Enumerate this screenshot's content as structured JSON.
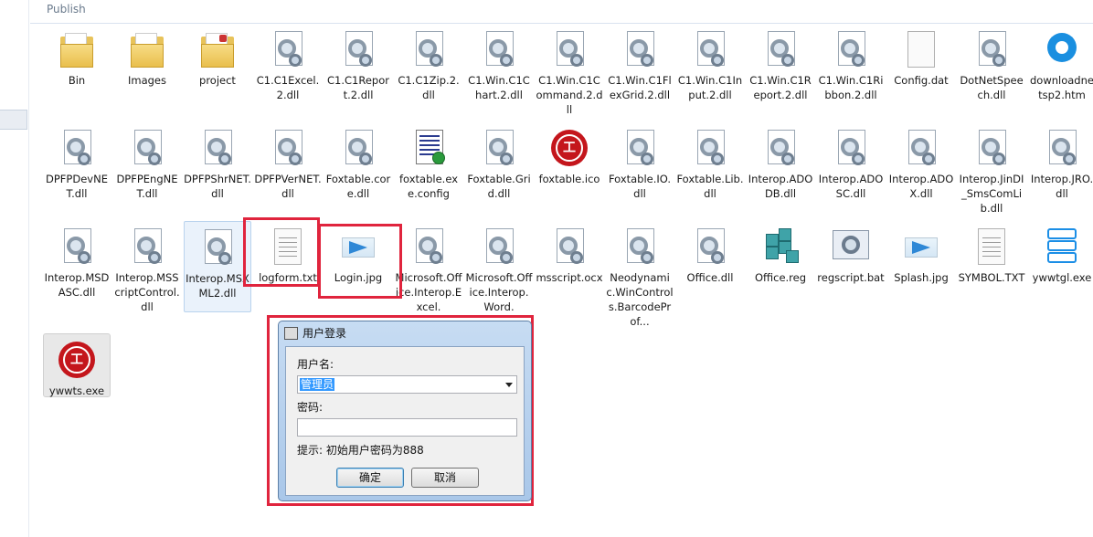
{
  "breadcrumb": "Publish",
  "files": [
    {
      "label": "Bin",
      "icon": "folder-icon"
    },
    {
      "label": "Images",
      "icon": "folder-icon"
    },
    {
      "label": "project",
      "icon": "folder-lock-icon"
    },
    {
      "label": "C1.C1Excel.2.dll",
      "icon": "dll-icon"
    },
    {
      "label": "C1.C1Report.2.dll",
      "icon": "dll-icon"
    },
    {
      "label": "C1.C1Zip.2.dll",
      "icon": "dll-icon"
    },
    {
      "label": "C1.Win.C1Chart.2.dll",
      "icon": "dll-icon"
    },
    {
      "label": "C1.Win.C1Command.2.dll",
      "icon": "dll-icon"
    },
    {
      "label": "C1.Win.C1FlexGrid.2.dll",
      "icon": "dll-icon"
    },
    {
      "label": "C1.Win.C1Input.2.dll",
      "icon": "dll-icon"
    },
    {
      "label": "C1.Win.C1Report.2.dll",
      "icon": "dll-icon"
    },
    {
      "label": "C1.Win.C1Ribbon.2.dll",
      "icon": "dll-icon"
    },
    {
      "label": "Config.dat",
      "icon": "blank-file-icon"
    },
    {
      "label": "DotNetSpeech.dll",
      "icon": "dll-icon"
    },
    {
      "label": "downloadnetsp2.htm",
      "icon": "browser-icon"
    },
    {
      "label": "DPFPDevNET.dll",
      "icon": "dll-icon"
    },
    {
      "label": "DPFPEngNET.dll",
      "icon": "dll-icon"
    },
    {
      "label": "DPFPShrNET.dll",
      "icon": "dll-icon"
    },
    {
      "label": "DPFPVerNET.dll",
      "icon": "dll-icon"
    },
    {
      "label": "Foxtable.core.dll",
      "icon": "dll-icon"
    },
    {
      "label": "foxtable.exe.config",
      "icon": "config-file-icon"
    },
    {
      "label": "Foxtable.Grid.dll",
      "icon": "dll-icon"
    },
    {
      "label": "foxtable.ico",
      "icon": "red-logo-icon"
    },
    {
      "label": "Foxtable.IO.dll",
      "icon": "dll-icon"
    },
    {
      "label": "Foxtable.Lib.dll",
      "icon": "dll-icon"
    },
    {
      "label": "Interop.ADODB.dll",
      "icon": "dll-icon"
    },
    {
      "label": "Interop.ADOSC.dll",
      "icon": "dll-icon"
    },
    {
      "label": "Interop.ADOX.dll",
      "icon": "dll-icon"
    },
    {
      "label": "Interop.JinDI_SmsComLib.dll",
      "icon": "dll-icon"
    },
    {
      "label": "Interop.JRO.dll",
      "icon": "dll-icon"
    },
    {
      "label": "Interop.MSDASC.dll",
      "icon": "dll-icon"
    },
    {
      "label": "Interop.MSScriptControl.dll",
      "icon": "dll-icon"
    },
    {
      "label": "Interop.MSXML2.dll",
      "icon": "dll-icon"
    },
    {
      "label": "logform.txt",
      "icon": "text-file-icon"
    },
    {
      "label": "Login.jpg",
      "icon": "image-file-icon"
    },
    {
      "label": "Microsoft.Office.Interop.Excel.",
      "icon": "dll-icon"
    },
    {
      "label": "Microsoft.Office.Interop.Word.",
      "icon": "dll-icon"
    },
    {
      "label": "msscript.ocx",
      "icon": "dll-icon"
    },
    {
      "label": "Neodynamic.WinControls.BarcodeProf...",
      "icon": "dll-icon"
    },
    {
      "label": "Office.dll",
      "icon": "dll-icon"
    },
    {
      "label": "Office.reg",
      "icon": "registry-file-icon"
    },
    {
      "label": "regscript.bat",
      "icon": "batch-file-icon"
    },
    {
      "label": "Splash.jpg",
      "icon": "image-file-icon"
    },
    {
      "label": "SYMBOL.TXT",
      "icon": "text-file-icon"
    },
    {
      "label": "ywwtgl.exe",
      "icon": "app-icon"
    },
    {
      "label": "ywwts.exe",
      "icon": "red-logo-icon"
    }
  ],
  "dialog": {
    "title": "用户登录",
    "username_label": "用户名:",
    "username_value": "管理员",
    "password_label": "密码:",
    "password_value": "",
    "hint": "提示: 初始用户密码为888",
    "ok_label": "确定",
    "cancel_label": "取消"
  },
  "colors": {
    "highlight_box": "#e0243d",
    "selection": "#3399ff"
  }
}
